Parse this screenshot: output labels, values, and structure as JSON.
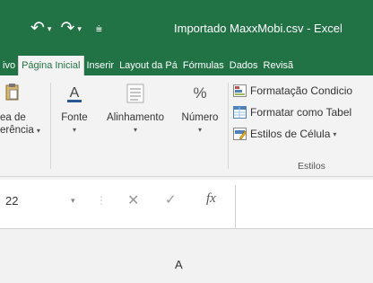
{
  "titlebar": {
    "window_title": "Importado MaxxMobi.csv - Excel",
    "undo_icon": "undo-icon",
    "redo_icon": "redo-icon",
    "customize_icon": "customize-qat-icon",
    "bg_color": "#217346"
  },
  "tabs": [
    {
      "label": "ivo",
      "active": false
    },
    {
      "label": "Página Inicial",
      "active": true
    },
    {
      "label": "Inserir",
      "active": false
    },
    {
      "label": "Layout da Pá",
      "active": false
    },
    {
      "label": "Fórmulas",
      "active": false
    },
    {
      "label": "Dados",
      "active": false
    },
    {
      "label": "Revisã",
      "active": false
    }
  ],
  "ribbon": {
    "clipboard": {
      "label_line1": "ea de",
      "label_line2": "erência",
      "icon": "paste-icon"
    },
    "font": {
      "label": "Fonte",
      "icon": "font-color-icon",
      "glyph": "A"
    },
    "alignment": {
      "label": "Alinhamento",
      "icon": "align-icon"
    },
    "number": {
      "label": "Número",
      "icon": "percent-icon",
      "glyph": "%"
    },
    "styles": {
      "items": [
        {
          "label": "Formatação Condicio",
          "icon": "conditional-format-icon"
        },
        {
          "label": "Formatar como Tabel",
          "icon": "format-table-icon"
        },
        {
          "label": "Estilos de Célula",
          "icon": "cell-styles-icon"
        }
      ],
      "group_label": "Estilos"
    }
  },
  "formula_bar": {
    "namebox_value": "22",
    "cancel_glyph": "✕",
    "enter_glyph": "✓",
    "fx_label": "fx",
    "formula_value": ""
  },
  "grid": {
    "column_header": "A"
  }
}
